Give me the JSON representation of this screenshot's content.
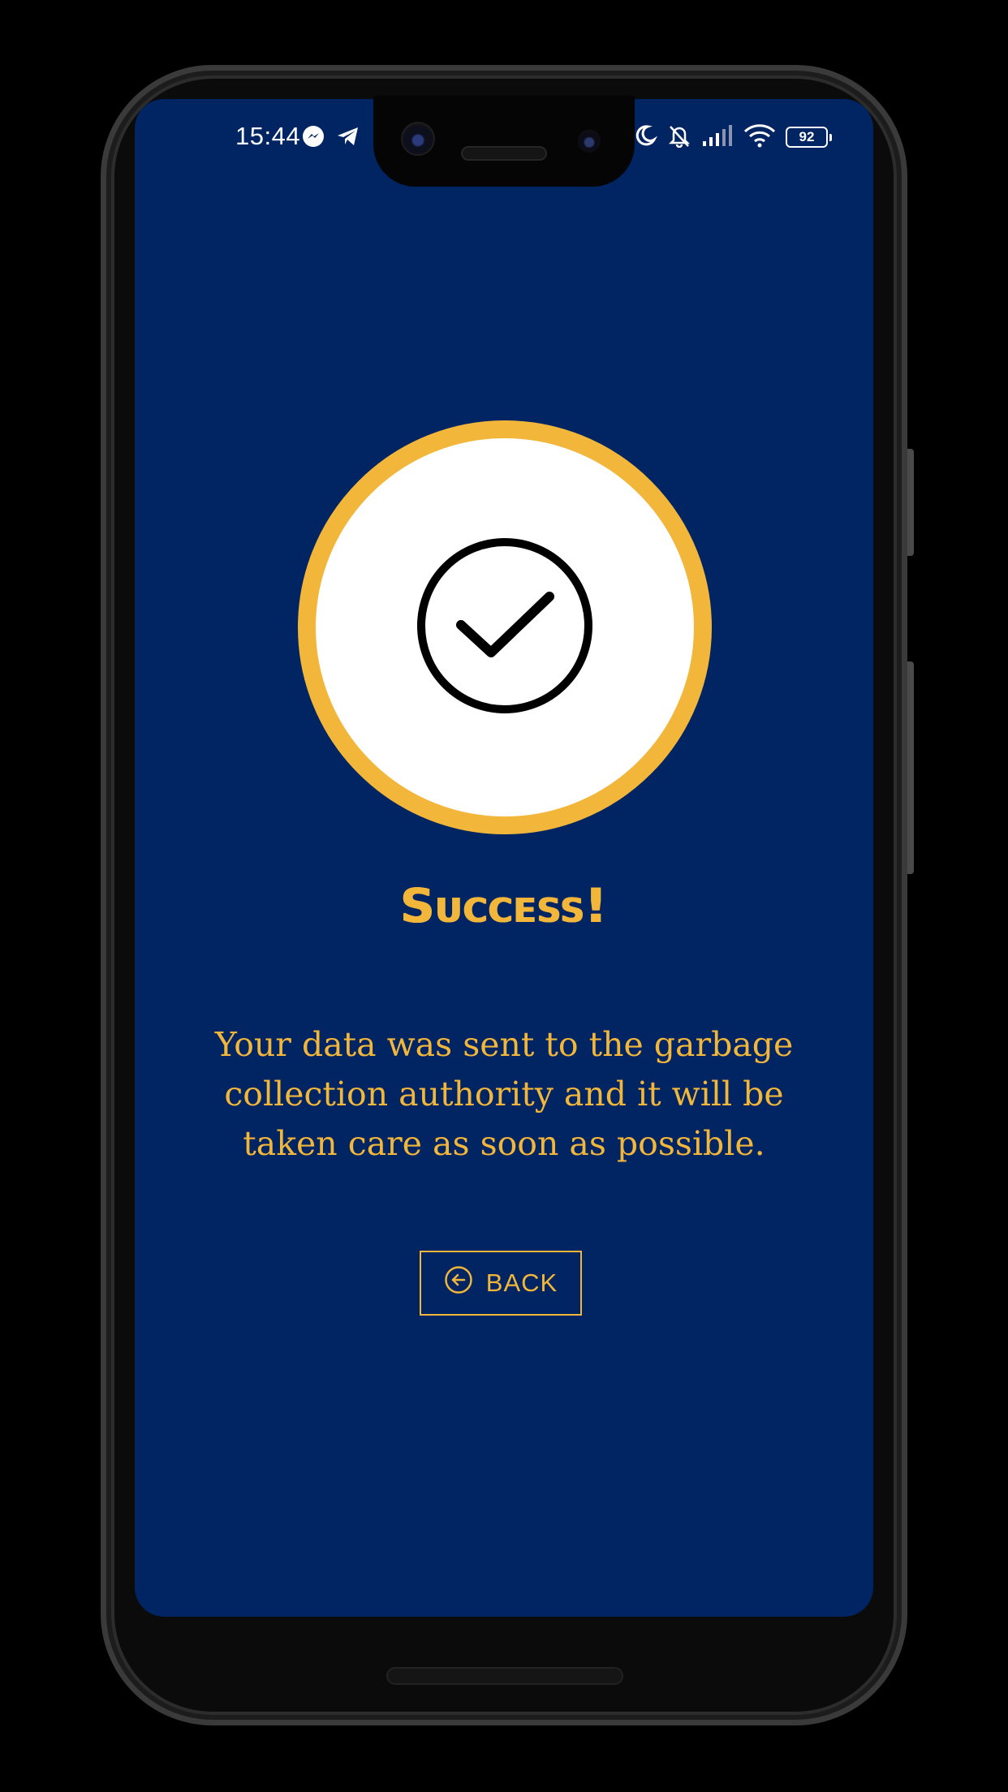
{
  "status_bar": {
    "time": "15:44",
    "battery_level": "92",
    "left_icons": [
      "messenger-icon",
      "telegram-icon"
    ],
    "right_icons": [
      "moon-icon",
      "bell-off-icon",
      "signal-icon",
      "wifi-icon",
      "battery-icon"
    ]
  },
  "success_screen": {
    "icon": "check-circle-icon",
    "title": "Success!",
    "message": "Your data was sent to the garbage collection authority and it will be taken care as soon as possible.",
    "back_button": {
      "label": "BACK",
      "icon": "arrow-left-circle-icon"
    }
  },
  "colors": {
    "background": "#012462",
    "accent": "#f2b63a",
    "circle_fill": "#ffffff",
    "check": "#000000"
  }
}
